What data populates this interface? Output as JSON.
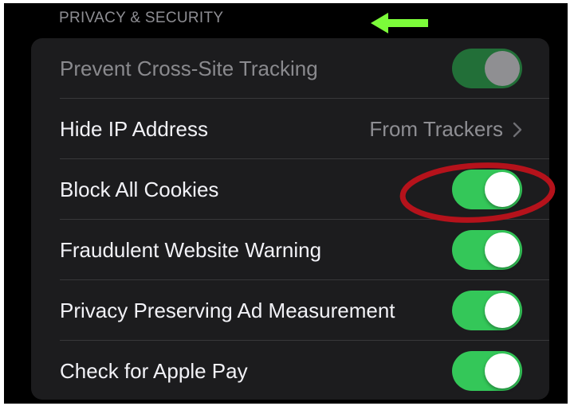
{
  "section": {
    "header": "PRIVACY & SECURITY"
  },
  "rows": [
    {
      "label": "Prevent Cross-Site Tracking",
      "control": "toggle",
      "on": true,
      "disabled": true
    },
    {
      "label": "Hide IP Address",
      "control": "detail",
      "detail": "From Trackers"
    },
    {
      "label": "Block All Cookies",
      "control": "toggle",
      "on": true
    },
    {
      "label": "Fraudulent Website Warning",
      "control": "toggle",
      "on": true
    },
    {
      "label": "Privacy Preserving Ad Measurement",
      "control": "toggle",
      "on": true
    },
    {
      "label": "Check for Apple Pay",
      "control": "toggle",
      "on": true
    }
  ],
  "colors": {
    "toggle_on": "#34c759",
    "toggle_disabled": "#226f38",
    "annotation_arrow": "#7CFC3A",
    "annotation_circle": "#b5121b",
    "background": "#000000",
    "card": "#1c1c1e"
  },
  "annotations": {
    "arrow_icon": "left-arrow-icon",
    "highlight": "red-ellipse-highlight"
  }
}
